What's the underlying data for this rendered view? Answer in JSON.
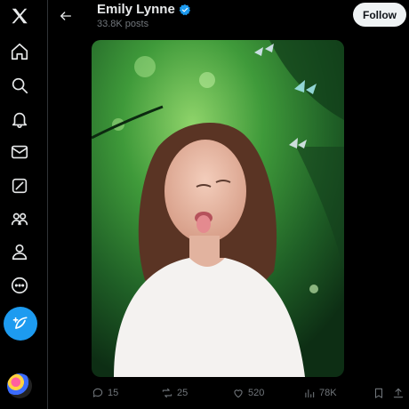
{
  "header": {
    "name": "Emily Lynne",
    "posts_count": "33.8K posts",
    "follow_label": "Follow"
  },
  "sidebar": {
    "items": [
      {
        "icon": "x-logo-icon"
      },
      {
        "icon": "home-icon"
      },
      {
        "icon": "search-icon"
      },
      {
        "icon": "bell-icon"
      },
      {
        "icon": "mail-icon"
      },
      {
        "icon": "grok-icon"
      },
      {
        "icon": "communities-icon"
      },
      {
        "icon": "profile-icon"
      },
      {
        "icon": "more-icon"
      }
    ],
    "post_icon": "feather-plus-icon"
  },
  "actions": {
    "replies": "15",
    "reposts": "25",
    "likes": "520",
    "views": "78K"
  },
  "colors": {
    "accent": "#1d9bf0",
    "background": "#000000",
    "text": "#e7e9ea",
    "muted": "#71767b"
  }
}
